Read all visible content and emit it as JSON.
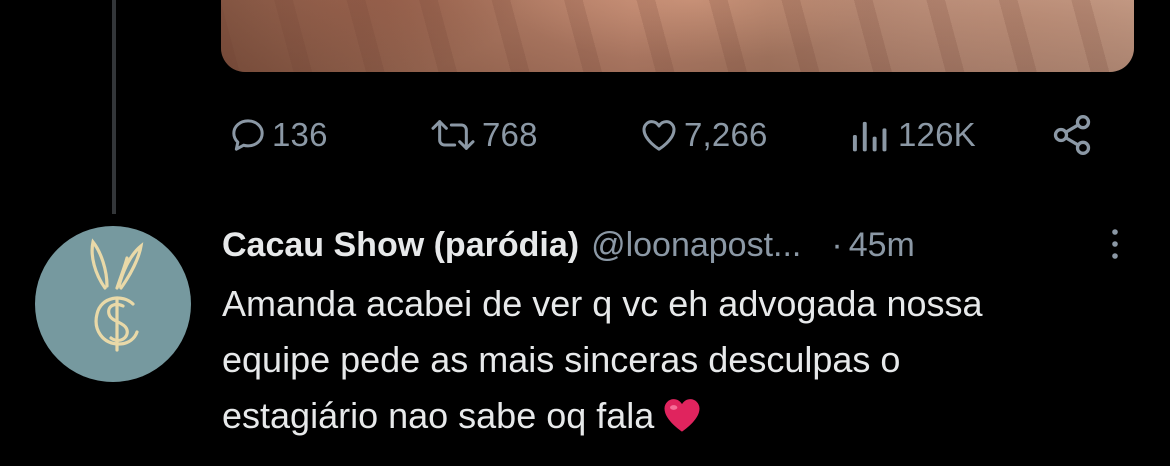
{
  "previous_tweet": {
    "actions": {
      "replies": "136",
      "retweets": "768",
      "likes": "7,266",
      "views": "126K"
    },
    "icons": [
      "reply-icon",
      "retweet-icon",
      "like-icon",
      "views-icon",
      "share-icon"
    ]
  },
  "tweet": {
    "display_name": "Cacau Show (paródia)",
    "handle": "@loonapost...",
    "separator": "·",
    "time": "45m",
    "text_lines": [
      "Amanda acabei de ver q vc eh advogada nossa",
      "equipe pede as mais sinceras desculpas o",
      "estagiário nao sabe oq fala"
    ],
    "emoji": "red-heart-emoji"
  },
  "colors": {
    "background": "#000000",
    "text_primary": "#e7e9ea",
    "text_secondary": "#8b98a5",
    "thread_line": "#333639",
    "avatar_bg": "#76999f",
    "avatar_logo": "#e9d9a8",
    "heart": "#e0245e"
  }
}
